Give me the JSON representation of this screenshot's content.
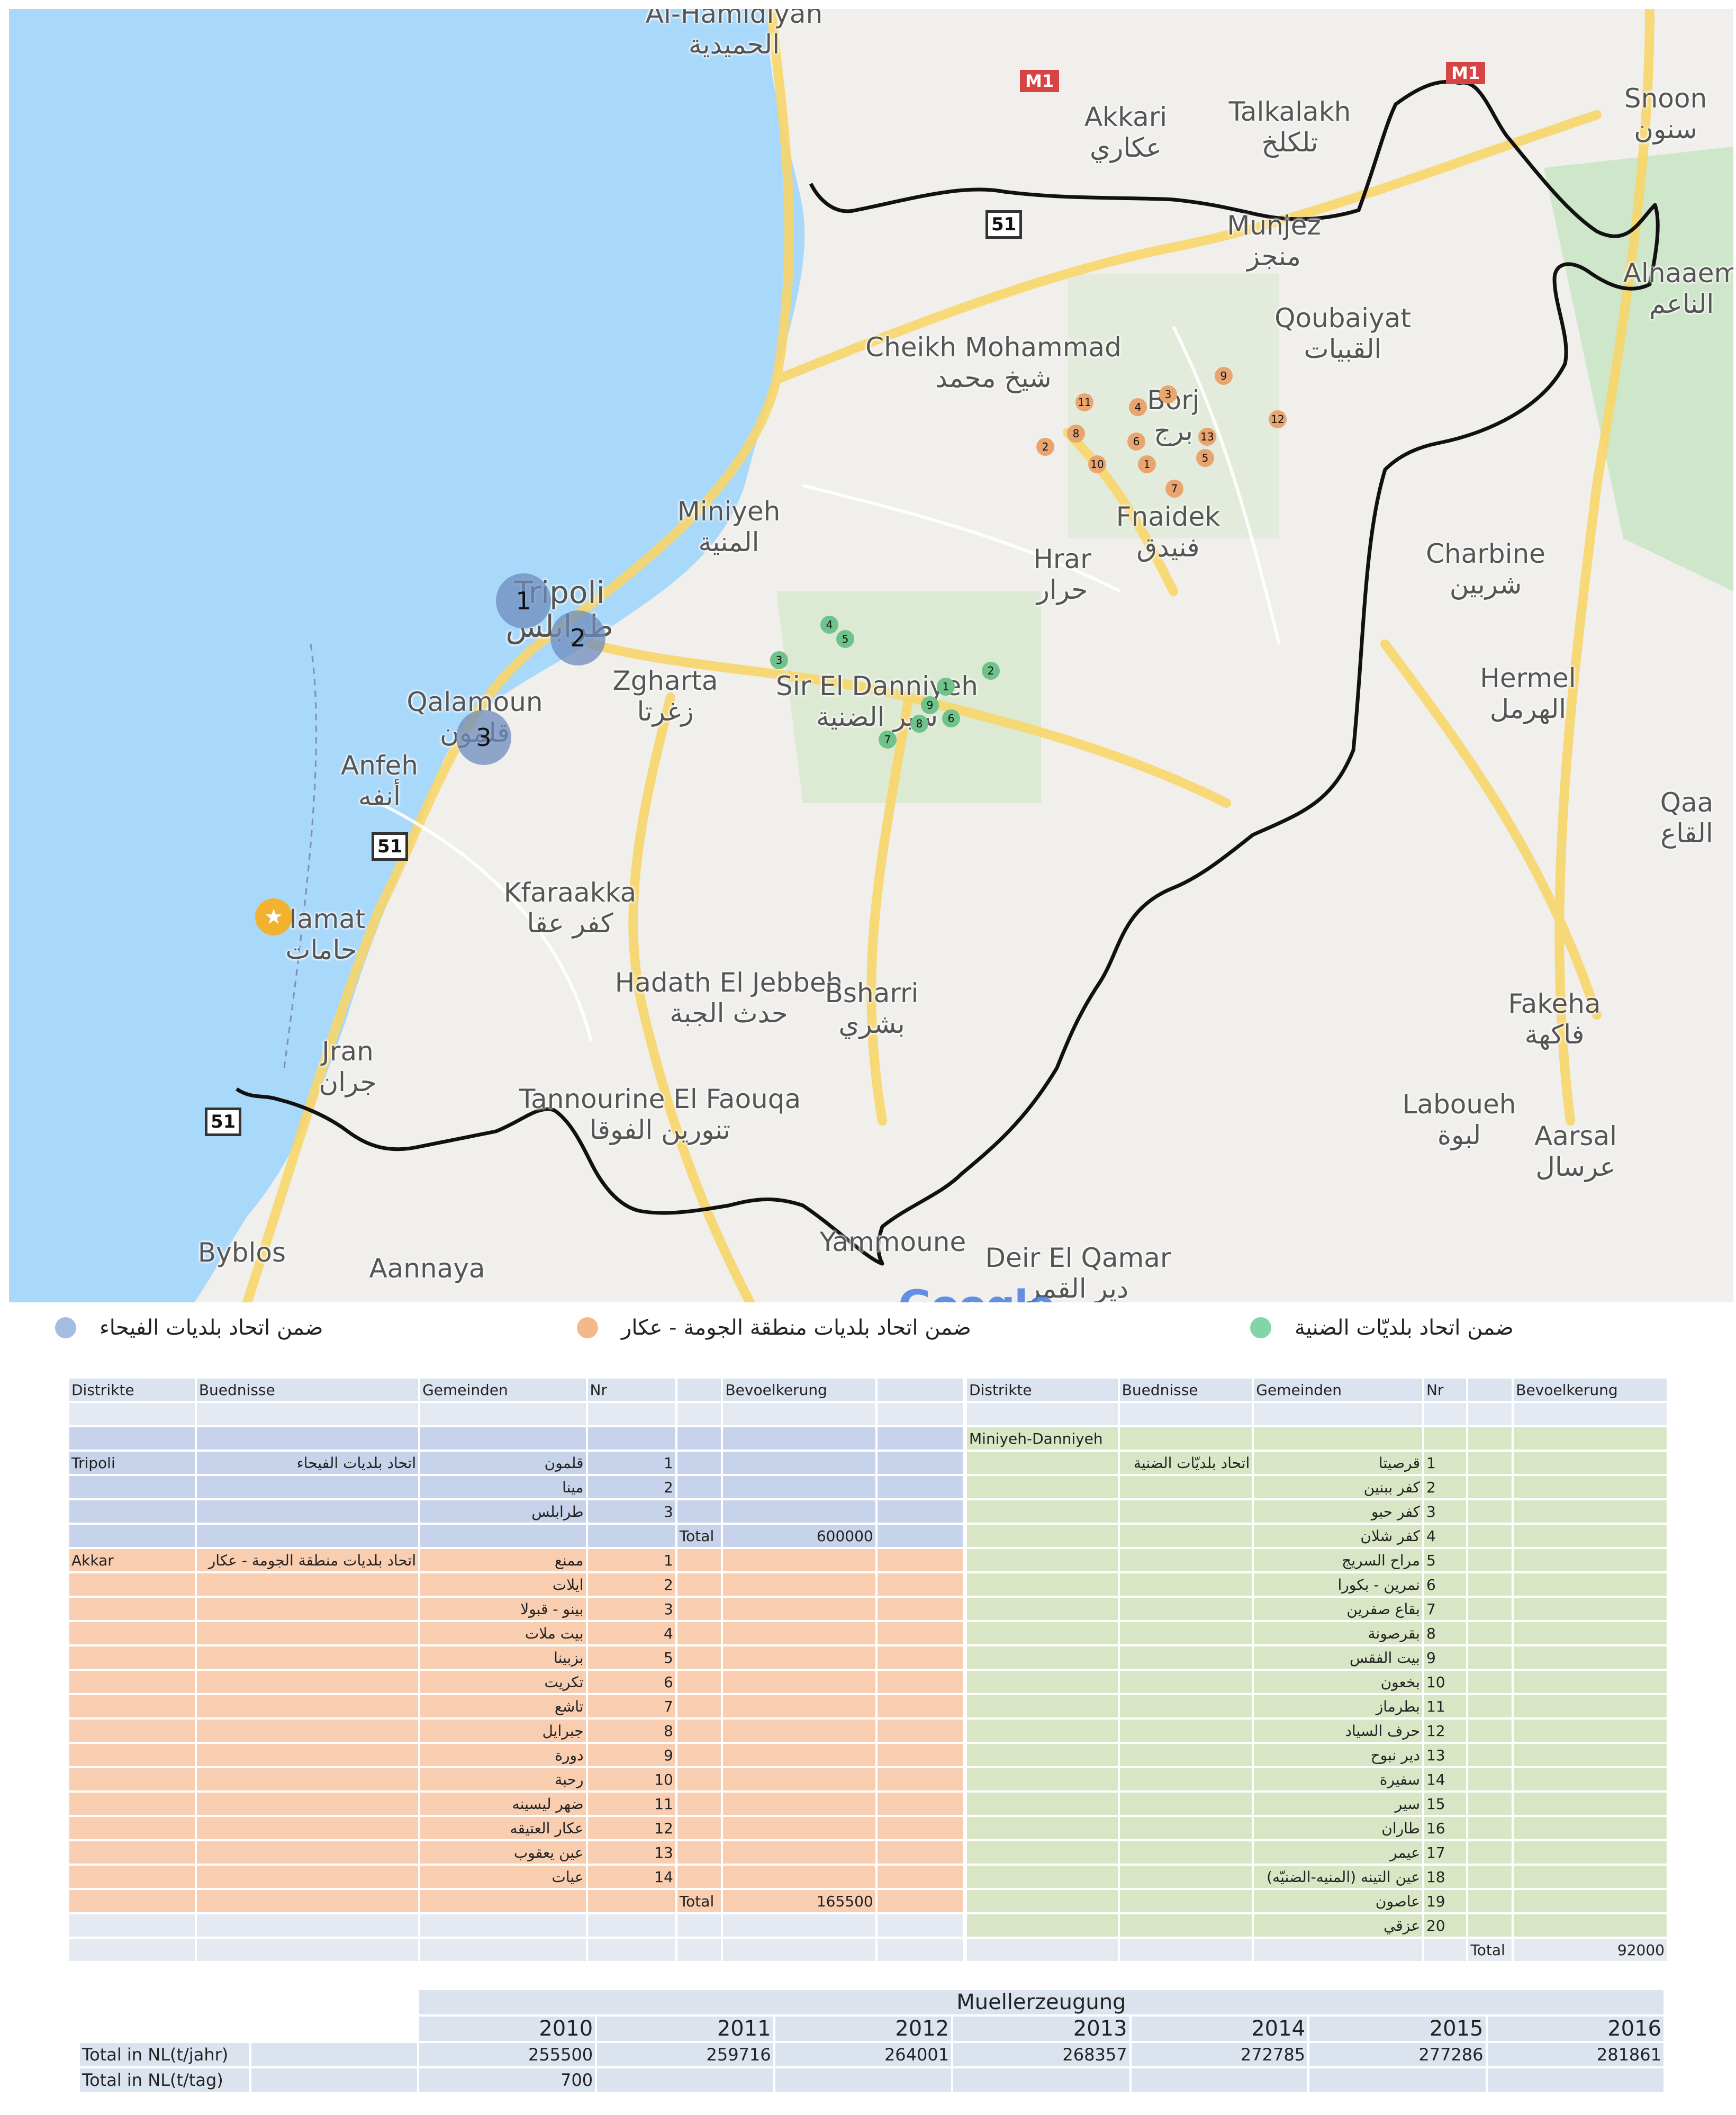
{
  "map": {
    "places": [
      {
        "id": "al-hamidiyah",
        "en": "Al-Hamidiyah",
        "ar": "الحميدية"
      },
      {
        "id": "akkari",
        "en": "Akkari",
        "ar": "عكاري"
      },
      {
        "id": "talkalakh",
        "en": "Talkalakh",
        "ar": "تلكلخ"
      },
      {
        "id": "snoon",
        "en": "Snoon",
        "ar": "سنون"
      },
      {
        "id": "munjez",
        "en": "Munjez",
        "ar": "منجز"
      },
      {
        "id": "alnaaem",
        "en": "Alnaaem",
        "ar": "الناعم"
      },
      {
        "id": "cheikh-mohammad",
        "en": "Cheikh Mohammad",
        "ar": "شيخ محمد"
      },
      {
        "id": "qoubaiyat",
        "en": "Qoubaiyat",
        "ar": "القبيات"
      },
      {
        "id": "borj",
        "en": "Borj",
        "ar": "برج"
      },
      {
        "id": "miniyeh",
        "en": "Miniyeh",
        "ar": "المنية"
      },
      {
        "id": "fnaidek",
        "en": "Fnaidek",
        "ar": "فنيدق"
      },
      {
        "id": "hrar",
        "en": "Hrar",
        "ar": "حرار"
      },
      {
        "id": "charbine",
        "en": "Charbine",
        "ar": "شربين"
      },
      {
        "id": "tripoli",
        "en": "Tripoli",
        "ar": "طرابلس"
      },
      {
        "id": "zgharta",
        "en": "Zgharta",
        "ar": "زغرتا"
      },
      {
        "id": "sir-el-danniyeh",
        "en": "Sir El Danniyeh",
        "ar": "سير الضنية"
      },
      {
        "id": "hermel",
        "en": "Hermel",
        "ar": "الهرمل"
      },
      {
        "id": "qalamoun",
        "en": "Qalamoun",
        "ar": "قلمون"
      },
      {
        "id": "anfeh",
        "en": "Anfeh",
        "ar": "أنفه"
      },
      {
        "id": "qaa",
        "en": "Qaa",
        "ar": "القاع"
      },
      {
        "id": "kfaraakka",
        "en": "Kfaraakka",
        "ar": "كفر عقا"
      },
      {
        "id": "hamat",
        "en": "Hamat",
        "ar": "حامات"
      },
      {
        "id": "hadath",
        "en": "Hadath El Jebbeh",
        "ar": "حدث الجبة"
      },
      {
        "id": "bsharri",
        "en": "Bsharri",
        "ar": "بشري"
      },
      {
        "id": "fakeha",
        "en": "Fakeha",
        "ar": "فاكهة"
      },
      {
        "id": "jran",
        "en": "Jran",
        "ar": "جران"
      },
      {
        "id": "tannourine",
        "en": "Tannourine El Faouqa",
        "ar": "تنورين الفوقا"
      },
      {
        "id": "laboueh",
        "en": "Laboueh",
        "ar": "لبوة"
      },
      {
        "id": "aarsal",
        "en": "Aarsal",
        "ar": "عرسال"
      },
      {
        "id": "byblos",
        "en": "Byblos",
        "ar": ""
      },
      {
        "id": "aannaya",
        "en": "Aannaya",
        "ar": ""
      },
      {
        "id": "yammoune",
        "en": "Yammoune",
        "ar": ""
      },
      {
        "id": "deir-el-qamar",
        "en": "Deir El Qamar",
        "ar": "دير القمر"
      }
    ],
    "road_shields": [
      "51",
      "51",
      "51",
      "M1",
      "M1"
    ],
    "blue_markers": [
      "1",
      "2",
      "3"
    ],
    "orange_markers": [
      "1",
      "2",
      "3",
      "4",
      "5",
      "6",
      "7",
      "8",
      "9",
      "10",
      "11",
      "12",
      "13"
    ],
    "green_markers": [
      "1",
      "2",
      "3",
      "4",
      "5",
      "6",
      "7",
      "8",
      "9"
    ],
    "watermark": "Google",
    "colors": {
      "sea": "#a8d8fa",
      "land": "#f0efec",
      "road": "#f8d66a",
      "border": "#111111"
    }
  },
  "legend": [
    {
      "label": "ضمن اتحاد بلديات الفيحاء",
      "color": "#a4bde0"
    },
    {
      "label": "ضمن اتحاد بلديات منطقة الجومة - عكار",
      "color": "#f4b98a"
    },
    {
      "label": "ضمن اتحاد بلديّات الضنية",
      "color": "#82d6a5"
    }
  ],
  "left_table": {
    "headers": [
      "Distrikte",
      "Buednisse",
      "Gemeinden",
      "Nr",
      "",
      "Bevoelkerung",
      ""
    ],
    "blue_rows": [
      [
        "Tripoli",
        "اتحاد بلديات الفيحاء",
        "قلمون",
        "1",
        "",
        "",
        ""
      ],
      [
        "",
        "",
        "مينا",
        "2",
        "",
        "",
        ""
      ],
      [
        "",
        "",
        "طرابلس",
        "3",
        "",
        "",
        ""
      ],
      [
        "",
        "",
        "",
        "",
        "Total",
        "600000",
        ""
      ]
    ],
    "orange_rows": [
      [
        "Akkar",
        "اتحاد بلديات منطقة الجومة - عكار",
        "ممنع",
        "1",
        "",
        "",
        ""
      ],
      [
        "",
        "",
        "ايلات",
        "2",
        "",
        "",
        ""
      ],
      [
        "",
        "",
        "بينو - قبولا",
        "3",
        "",
        "",
        ""
      ],
      [
        "",
        "",
        "بيت ملات",
        "4",
        "",
        "",
        ""
      ],
      [
        "",
        "",
        "بزبينا",
        "5",
        "",
        "",
        ""
      ],
      [
        "",
        "",
        "تكريت",
        "6",
        "",
        "",
        ""
      ],
      [
        "",
        "",
        "تاشع",
        "7",
        "",
        "",
        ""
      ],
      [
        "",
        "",
        "جبرايل",
        "8",
        "",
        "",
        ""
      ],
      [
        "",
        "",
        "دورة",
        "9",
        "",
        "",
        ""
      ],
      [
        "",
        "",
        "رحبة",
        "10",
        "",
        "",
        ""
      ],
      [
        "",
        "",
        "ضهر ليسينه",
        "11",
        "",
        "",
        ""
      ],
      [
        "",
        "",
        "عكار العتيقه",
        "12",
        "",
        "",
        ""
      ],
      [
        "",
        "",
        "عين يعقوب",
        "13",
        "",
        "",
        ""
      ],
      [
        "",
        "",
        "عيات",
        "14",
        "",
        "",
        ""
      ],
      [
        "",
        "",
        "",
        "",
        "Total",
        "165500",
        ""
      ]
    ]
  },
  "right_table": {
    "headers": [
      "Distrikte",
      "Buednisse",
      "Gemeinden",
      "Nr",
      "",
      "Bevoelkerung"
    ],
    "district": "Miniyeh-Danniyeh",
    "union": "اتحاد بلديّات الضنية",
    "rows": [
      [
        "قرصيتا",
        "1"
      ],
      [
        "كفر ببنين",
        "2"
      ],
      [
        "كفر حبو",
        "3"
      ],
      [
        "كفر شلان",
        "4"
      ],
      [
        "مراح السريج",
        "5"
      ],
      [
        "نمرين - بكورا",
        "6"
      ],
      [
        "بقاع صفرين",
        "7"
      ],
      [
        "بقرصونة",
        "8"
      ],
      [
        "بيت الفقس",
        "9"
      ],
      [
        "بخعون",
        "10"
      ],
      [
        "بطرماز",
        "11"
      ],
      [
        "حرف السياد",
        "12"
      ],
      [
        "دير نبوح",
        "13"
      ],
      [
        "سفيرة",
        "14"
      ],
      [
        "سير",
        "15"
      ],
      [
        "طاران",
        "16"
      ],
      [
        "عيمر",
        "17"
      ],
      [
        "عين التينه (المنيه-الضنيّه)",
        "18"
      ],
      [
        "عاصون",
        "19"
      ],
      [
        "عزقي",
        "20"
      ]
    ],
    "total_label": "Total",
    "total_value": "92000"
  },
  "production": {
    "title": "Muellerzeugung",
    "years": [
      "2010",
      "2011",
      "2012",
      "2013",
      "2014",
      "2015",
      "2016"
    ],
    "row1_label": "Total in NL(t/jahr)",
    "row1_values": [
      "255500",
      "259716",
      "264001",
      "268357",
      "272785",
      "277286",
      "281861"
    ],
    "row2_label": "Total in NL(t/tag)",
    "row2_values": [
      "700",
      "",
      "",
      "",
      "",
      "",
      ""
    ]
  }
}
